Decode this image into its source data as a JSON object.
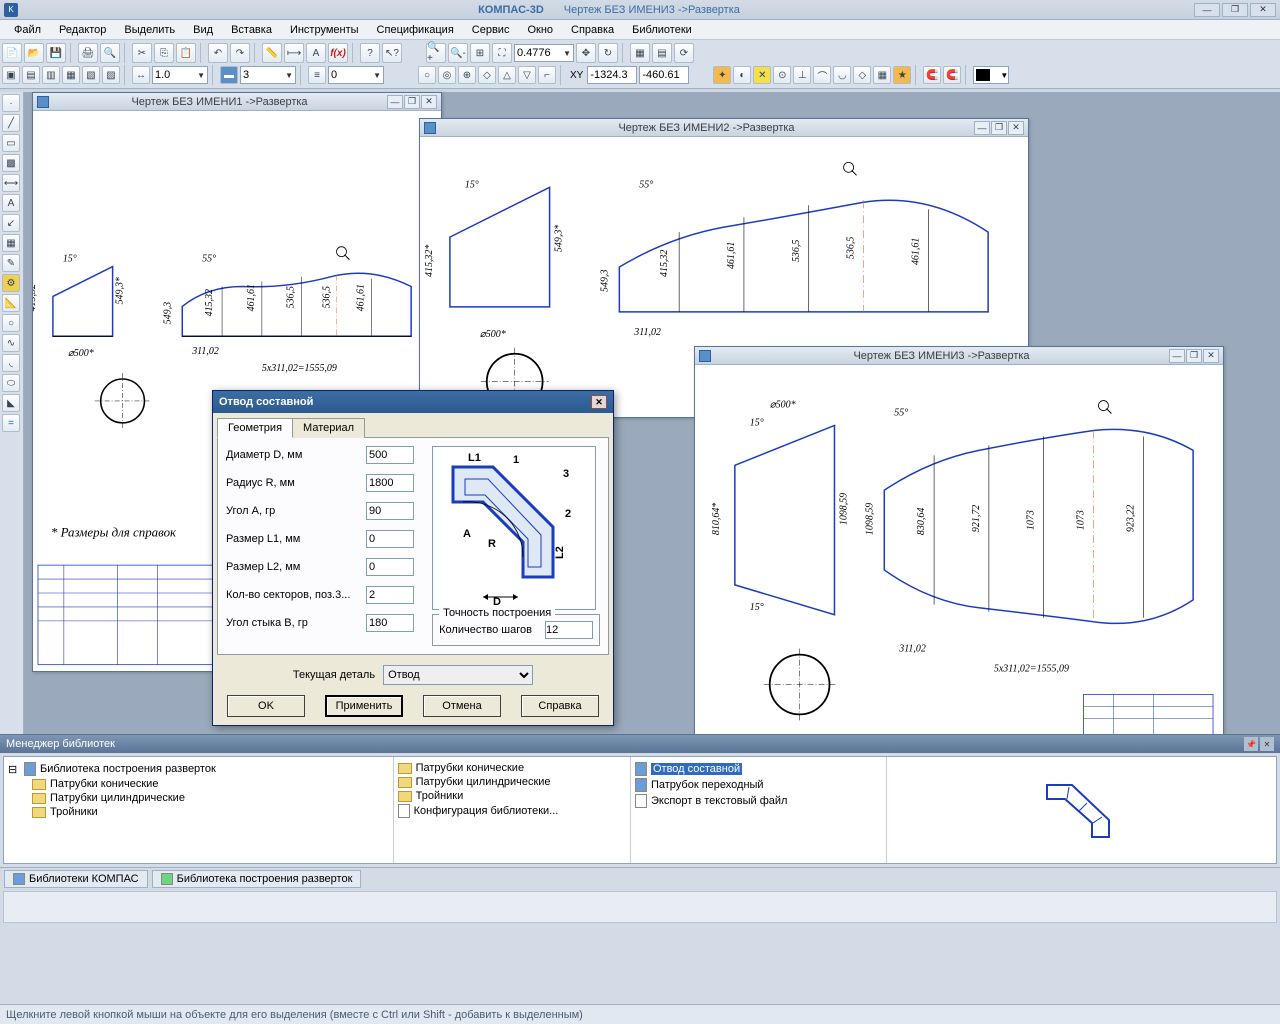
{
  "app": {
    "name": "КОМПАС-3D",
    "doc": "Чертеж БЕЗ ИМЕНИ3 ->Развертка"
  },
  "menu": [
    "Файл",
    "Редактор",
    "Выделить",
    "Вид",
    "Вставка",
    "Инструменты",
    "Спецификация",
    "Сервис",
    "Окно",
    "Справка",
    "Библиотеки"
  ],
  "toolbar": {
    "zoom": "0.4776",
    "scale": "1.0",
    "layer": "3",
    "style": "0",
    "coord_x": "-1324.3",
    "coord_y": "-460.61",
    "xy_label": "XY"
  },
  "windows": {
    "w1": "Чертеж БЕЗ ИМЕНИ1 ->Развертка",
    "w2": "Чертеж БЕЗ ИМЕНИ2 ->Развертка",
    "w3": "Чертеж БЕЗ ИМЕНИ3 ->Развертка"
  },
  "drawing": {
    "note": "* Размеры для справок",
    "dims": {
      "angle15": "15°",
      "angle55": "55°",
      "d41532": "415,32*",
      "d5493": "549,3*",
      "d46161": "461,61",
      "d5365": "536,5",
      "d500": "⌀500*",
      "d31102": "311,02",
      "pattern": "5x311,02=1555,09",
      "d81064": "810,64*",
      "d109859": "1098,59",
      "d83064": "830,64",
      "d92172": "921,72",
      "d1073": "1073",
      "d92322": "923,22"
    }
  },
  "dialog": {
    "title": "Отвод составной",
    "tabs": {
      "geom": "Геометрия",
      "mat": "Материал"
    },
    "params": {
      "d_label": "Диаметр D, мм",
      "d_val": "500",
      "r_label": "Радиус R, мм",
      "r_val": "1800",
      "a_label": "Угол А, гр",
      "a_val": "90",
      "l1_label": "Размер L1, мм",
      "l1_val": "0",
      "l2_label": "Размер L2, мм",
      "l2_val": "0",
      "sec_label": "Кол-во секторов, поз.3...",
      "sec_val": "2",
      "joint_label": "Угол стыка В, гр",
      "joint_val": "180"
    },
    "accuracy": {
      "group": "Точность построения",
      "steps_label": "Количество шагов",
      "steps_val": "12"
    },
    "detail": {
      "label": "Текущая деталь",
      "val": "Отвод"
    },
    "buttons": {
      "ok": "OK",
      "apply": "Применить",
      "cancel": "Отмена",
      "help": "Справка"
    }
  },
  "lib": {
    "title": "Менеджер библиотек",
    "tree_root": "Библиотека построения разверток",
    "tree": [
      "Патрубки конические",
      "Патрубки цилиндрические",
      "Тройники"
    ],
    "col2": [
      "Патрубки конические",
      "Патрубки цилиндрические",
      "Тройники",
      "Конфигурация библиотеки..."
    ],
    "col3": {
      "sel": "Отвод составной",
      "i2": "Патрубок переходный",
      "i3": "Экспорт в текстовый файл"
    },
    "tabs": {
      "t1": "Библиотеки КОМПАС",
      "t2": "Библиотека построения разверток"
    }
  },
  "status": "Щелкните левой кнопкой мыши на объекте для его выделения (вместе с Ctrl или Shift - добавить к выделенным)"
}
